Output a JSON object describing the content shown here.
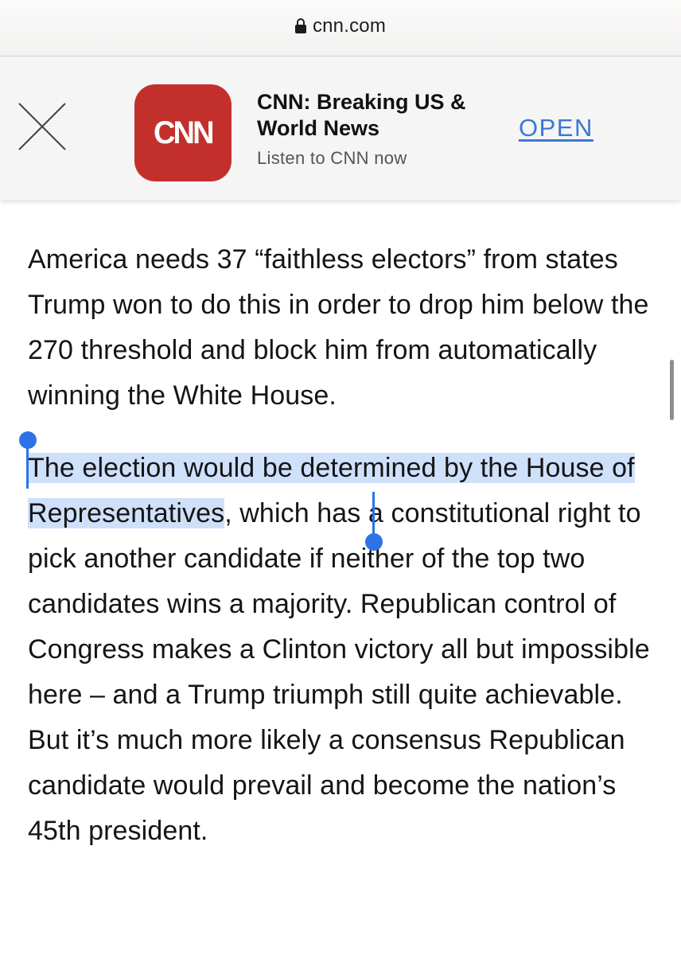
{
  "browser": {
    "url": "cnn.com",
    "lock_icon": "lock-icon"
  },
  "banner": {
    "close_icon": "close-icon",
    "logo_text": "CNN",
    "logo_color": "#c3302c",
    "app_name": "CNN: Breaking US & World News",
    "subtitle": "Listen to CNN now",
    "open_label": "OPEN",
    "open_color": "#3a78d8"
  },
  "article": {
    "paragraph1": "America needs 37 “faithless electors” from states Trump won to do this in order to drop him below the 270 threshold and block him from automatically winning the White House.",
    "paragraph2_selected": "The election would be determined by the House of Representatives",
    "paragraph2_rest": ", which has a constitutional right to pick another candidate if neither of the top two candidates wins a majority. Republican control of Congress makes a Clinton victory all but impossible here – and a Trump triumph still quite achievable. But it’s much more likely a consensus Republican candidate would prevail and become the nation’s 45th president."
  },
  "selection": {
    "highlight_color": "#cfe0fb",
    "handle_color": "#2c73e6"
  }
}
